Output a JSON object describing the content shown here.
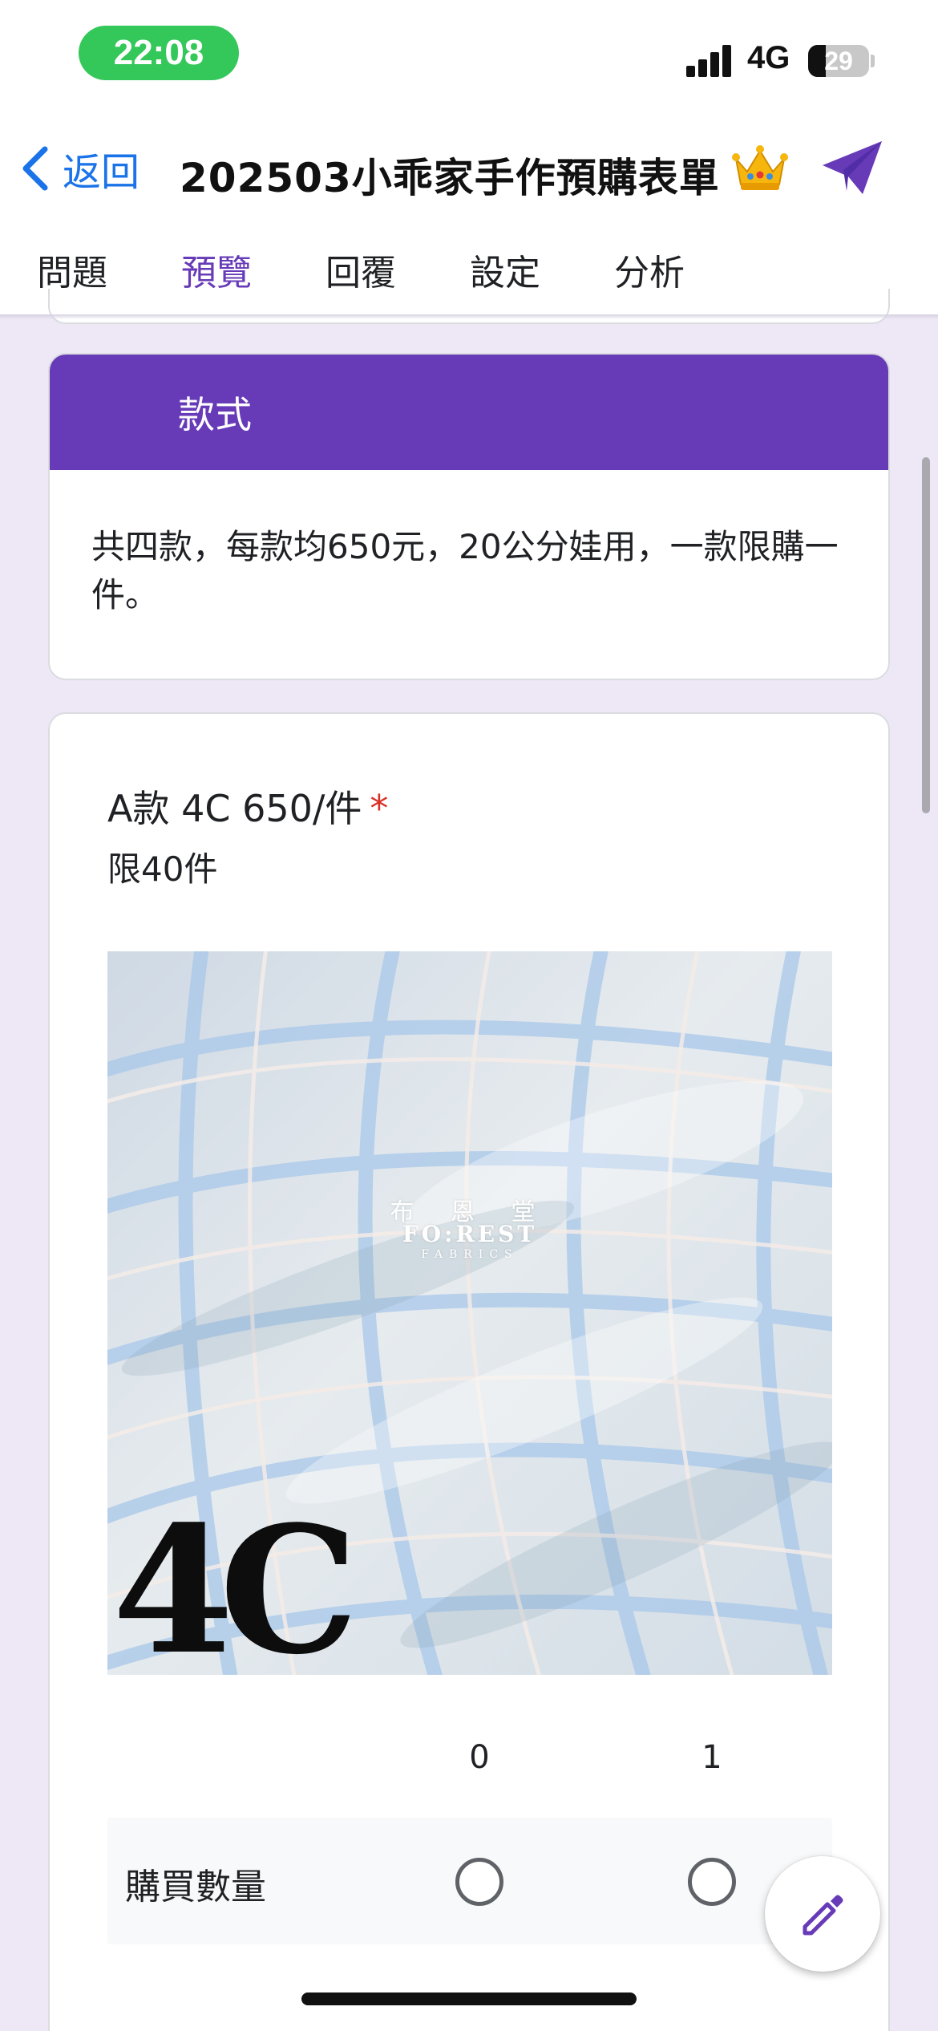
{
  "status_bar": {
    "time": "22:08",
    "network": "4G",
    "battery": "29",
    "battery_level": 0.29,
    "signal_icon": "cellular-signal-icon"
  },
  "header": {
    "back_label": "返回",
    "title": "202503小乖家手作預購表單",
    "back_icon": "chevron-left-icon",
    "theme_icon": "crown-icon",
    "send_icon": "send-paper-plane-icon"
  },
  "tabs": [
    {
      "label": "問題",
      "active": false
    },
    {
      "label": "預覽",
      "active": true
    },
    {
      "label": "回覆",
      "active": false
    },
    {
      "label": "設定",
      "active": false
    },
    {
      "label": "分析",
      "active": false
    }
  ],
  "section": {
    "title": "款式",
    "description": "共四款，每款均650元，20公分娃用，一款限購一件。"
  },
  "question": {
    "title": "A款 4C 650/件",
    "required_mark": "*",
    "subtitle": "限40件",
    "image": {
      "watermark_cn": "布 恩 堂",
      "watermark_en": "FO:REST",
      "watermark_sub": "FABRICS",
      "code": "4C"
    },
    "columns": [
      "0",
      "1"
    ],
    "rows": [
      {
        "label": "購買數量"
      }
    ]
  },
  "fab_icon": "pencil-edit-icon",
  "colors": {
    "accent": "#673ab7",
    "link": "#1a73e8",
    "background": "#ede7f6",
    "required": "#d93025",
    "status_pill": "#34c759"
  }
}
